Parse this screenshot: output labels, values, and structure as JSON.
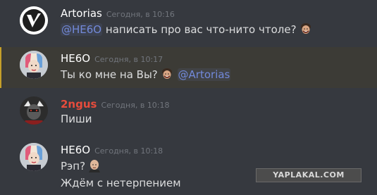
{
  "messages": [
    {
      "author": "Artorias",
      "timestamp": "Сегодня, в 10:16",
      "mention": "@HE6O",
      "text": "написать про вас что-нито чтоле?",
      "emoji": "laughing-man-emoji",
      "avatar": "artorias-logo-avatar"
    },
    {
      "author": "HE6O",
      "timestamp": "Сегодня, в 10:17",
      "text": "Ты ко мне на Вы?",
      "emoji": "laughing-man-emoji",
      "mention": "@Artorias",
      "avatar": "harley-quinn-avatar",
      "highlight_color": "#c6a02a"
    },
    {
      "author": "2ngus",
      "author_color": "#e74c3c",
      "timestamp": "Сегодня, в 10:18",
      "text": "Пиши",
      "avatar": "hero-avatar"
    },
    {
      "author": "HE6O",
      "timestamp": "Сегодня, в 10:18",
      "text": "Рэп?",
      "emoji": "bald-man-emoji",
      "text2": "Ждём с нетерпением",
      "avatar": "harley-quinn-avatar"
    }
  ],
  "watermark": "YAPLAKAL.COM",
  "colors": {
    "background": "#36393f",
    "mention": "#7289da",
    "timestamp": "#72767d",
    "text": "#dcddde"
  }
}
